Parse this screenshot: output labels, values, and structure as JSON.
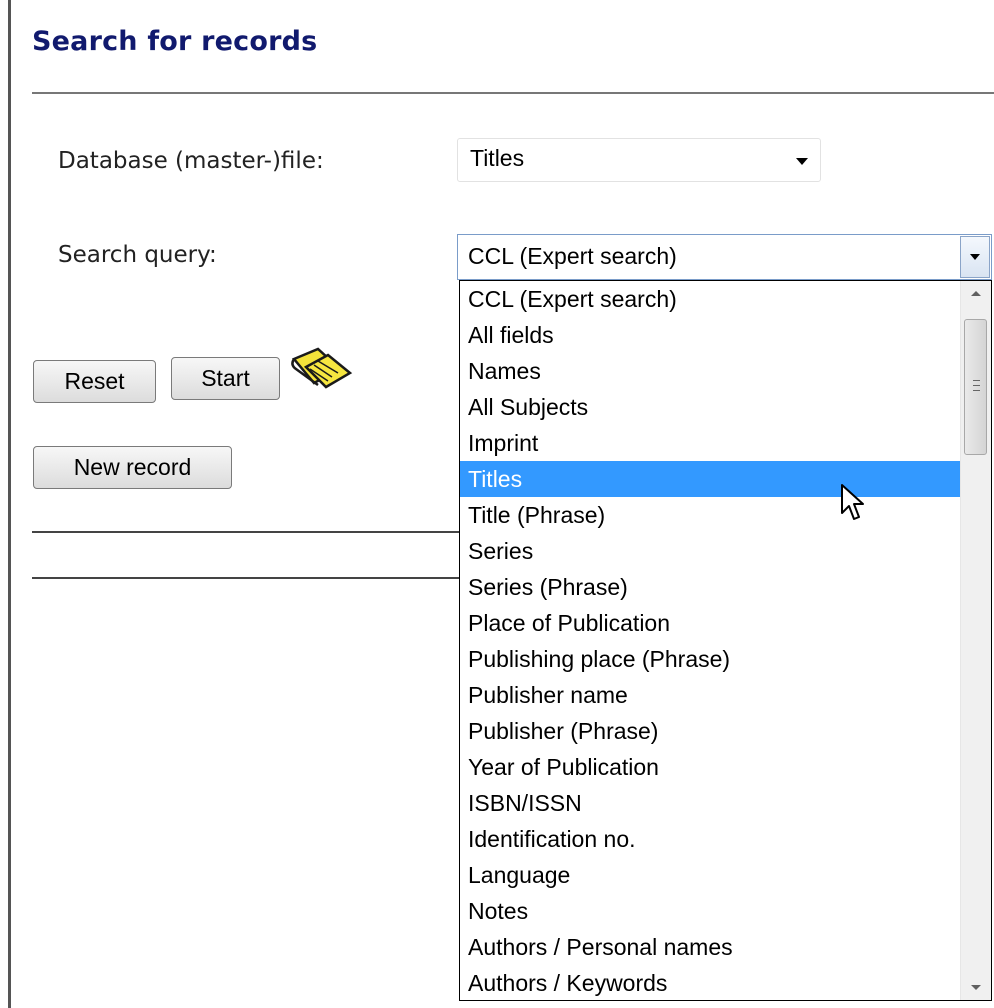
{
  "page": {
    "title": "Search for records"
  },
  "form": {
    "database_label": "Database (master-)file:",
    "database_value": "Titles",
    "query_label": "Search query:",
    "query_value": "CCL (Expert search)"
  },
  "buttons": {
    "reset": "Reset",
    "start": "Start",
    "new_record": "New record"
  },
  "dropdown": {
    "selected_index": 5,
    "scroll_position": 0.0,
    "items": [
      "CCL (Expert search)",
      "All fields",
      "Names",
      "All Subjects",
      "Imprint",
      "Titles",
      "Title (Phrase)",
      "Series",
      "Series (Phrase)",
      "Place of Publication",
      "Publishing place (Phrase)",
      "Publisher name",
      "Publisher (Phrase)",
      "Year of Publication",
      "ISBN/ISSN",
      "Identification no.",
      "Language",
      "Notes",
      "Authors / Personal names",
      "Authors / Keywords"
    ]
  },
  "colors": {
    "title": "#111a6e",
    "highlight": "#3399ff"
  },
  "icons": {
    "book": "open-book-icon",
    "cursor": "mouse-pointer-icon"
  }
}
